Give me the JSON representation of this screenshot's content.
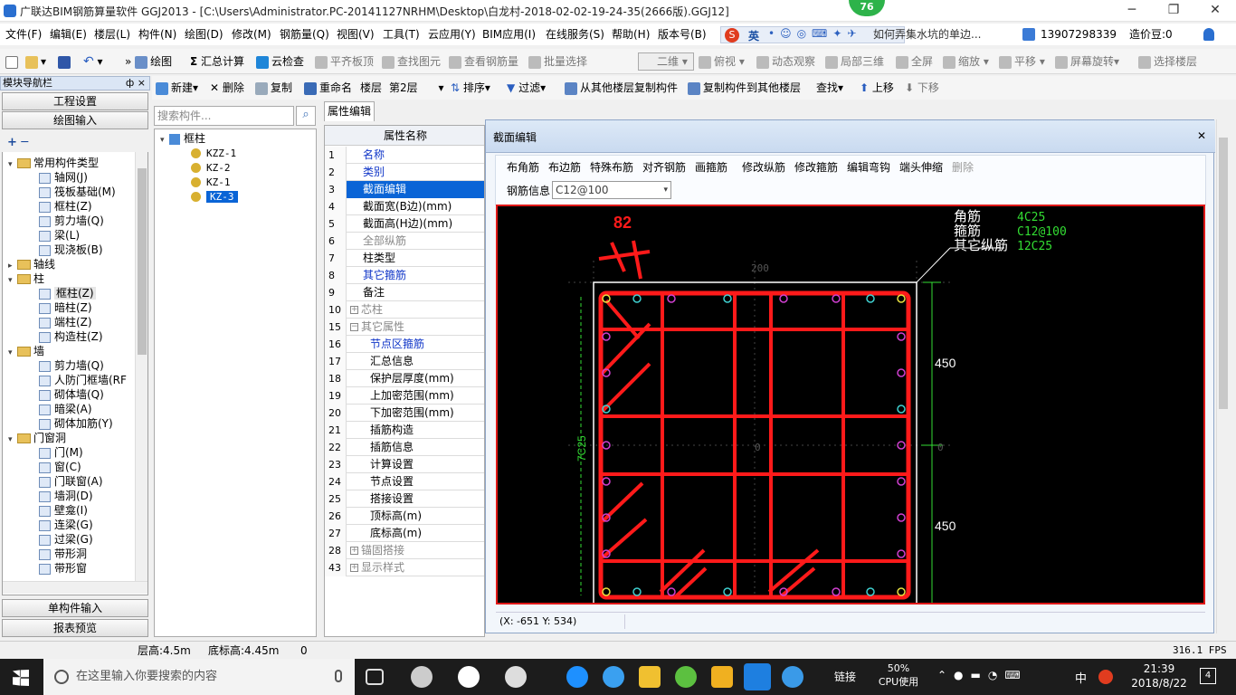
{
  "window": {
    "title": "广联达BIM钢筋算量软件 GGJ2013 - [C:\\Users\\Administrator.PC-20141127NRHM\\Desktop\\白龙村-2018-02-02-19-24-35(2666版).GGJ12]",
    "notification_count": "76"
  },
  "menu": [
    "文件(F)",
    "编辑(E)",
    "楼层(L)",
    "构件(N)",
    "绘图(D)",
    "修改(M)",
    "钢筋量(Q)",
    "视图(V)",
    "工具(T)",
    "云应用(Y)",
    "BIM应用(I)",
    "在线服务(S)",
    "帮助(H)",
    "版本号(B)"
  ],
  "menu_right": {
    "ime_label": "英",
    "news_text": "如何弄集水坑的单边...",
    "phone": "13907298339",
    "coins": "造价豆:0"
  },
  "toolbar1": {
    "draw": "绘图",
    "sum": "汇总计算",
    "cloud_check": "云检查",
    "flush_slab": "平齐板顶",
    "find_elem": "查找图元",
    "view_rebar": "查看钢筋量",
    "batch_select": "批量选择",
    "view_mode": "二维",
    "top_view": "俯视",
    "dynamic": "动态观察",
    "local3d": "局部三维",
    "fullscreen": "全屏",
    "zoom": "缩放",
    "pan": "平移",
    "rotate": "屏幕旋转",
    "select_floor": "选择楼层"
  },
  "toolbar2": {
    "new": "新建",
    "delete": "删除",
    "copy": "复制",
    "rename": "重命名",
    "floor_label": "楼层",
    "floor_value": "第2层",
    "sort": "排序",
    "filter": "过滤",
    "copy_from": "从其他楼层复制构件",
    "copy_to": "复制构件到其他楼层",
    "find": "查找",
    "up": "上移",
    "down": "下移"
  },
  "nav": {
    "title": "模块导航栏",
    "pin": "ф ×",
    "project_settings": "工程设置",
    "drawing_input": "绘图输入",
    "single_input": "单构件输入",
    "report_preview": "报表预览"
  },
  "tree": [
    {
      "label": "常用构件类型",
      "type": "folder",
      "expanded": "-"
    },
    {
      "label": "轴网(J)",
      "type": "item"
    },
    {
      "label": "筏板基础(M)",
      "type": "item"
    },
    {
      "label": "框柱(Z)",
      "type": "item"
    },
    {
      "label": "剪力墙(Q)",
      "type": "item"
    },
    {
      "label": "梁(L)",
      "type": "item"
    },
    {
      "label": "现浇板(B)",
      "type": "item"
    },
    {
      "label": "轴线",
      "type": "folder",
      "expanded": "+"
    },
    {
      "label": "柱",
      "type": "folder",
      "expanded": "-"
    },
    {
      "label": "框柱(Z)",
      "type": "item",
      "selected": true
    },
    {
      "label": "暗柱(Z)",
      "type": "item"
    },
    {
      "label": "端柱(Z)",
      "type": "item"
    },
    {
      "label": "构造柱(Z)",
      "type": "item"
    },
    {
      "label": "墙",
      "type": "folder",
      "expanded": "-"
    },
    {
      "label": "剪力墙(Q)",
      "type": "item"
    },
    {
      "label": "人防门框墙(RF",
      "type": "item"
    },
    {
      "label": "砌体墙(Q)",
      "type": "item"
    },
    {
      "label": "暗梁(A)",
      "type": "item"
    },
    {
      "label": "砌体加筋(Y)",
      "type": "item"
    },
    {
      "label": "门窗洞",
      "type": "folder",
      "expanded": "-"
    },
    {
      "label": "门(M)",
      "type": "item"
    },
    {
      "label": "窗(C)",
      "type": "item"
    },
    {
      "label": "门联窗(A)",
      "type": "item"
    },
    {
      "label": "墙洞(D)",
      "type": "item"
    },
    {
      "label": "壁龛(I)",
      "type": "item"
    },
    {
      "label": "连梁(G)",
      "type": "item"
    },
    {
      "label": "过梁(G)",
      "type": "item"
    },
    {
      "label": "带形洞",
      "type": "item"
    },
    {
      "label": "带形窗",
      "type": "item"
    }
  ],
  "components": {
    "search_placeholder": "搜索构件...",
    "root": "框柱",
    "items": [
      "KZZ-1",
      "KZ-2",
      "KZ-1",
      "KZ-3"
    ]
  },
  "props": {
    "tab": "属性编辑",
    "header": "属性名称",
    "rows": [
      {
        "n": "1",
        "label": "名称",
        "style": "blue"
      },
      {
        "n": "2",
        "label": "类别",
        "style": "blue"
      },
      {
        "n": "3",
        "label": "截面编辑",
        "style": "sel"
      },
      {
        "n": "4",
        "label": "截面宽(B边)(mm)",
        "style": ""
      },
      {
        "n": "5",
        "label": "截面高(H边)(mm)",
        "style": ""
      },
      {
        "n": "6",
        "label": "全部纵筋",
        "style": "gray"
      },
      {
        "n": "7",
        "label": "柱类型",
        "style": ""
      },
      {
        "n": "8",
        "label": "其它箍筋",
        "style": "blue"
      },
      {
        "n": "9",
        "label": "备注",
        "style": ""
      },
      {
        "n": "10",
        "label": "芯柱",
        "style": "gray",
        "plus": "+"
      },
      {
        "n": "15",
        "label": "其它属性",
        "style": "gray",
        "plus": "-"
      },
      {
        "n": "16",
        "label": "节点区箍筋",
        "style": "blue",
        "indent": true
      },
      {
        "n": "17",
        "label": "汇总信息",
        "style": "",
        "indent": true
      },
      {
        "n": "18",
        "label": "保护层厚度(mm)",
        "style": "",
        "indent": true
      },
      {
        "n": "19",
        "label": "上加密范围(mm)",
        "style": "",
        "indent": true
      },
      {
        "n": "20",
        "label": "下加密范围(mm)",
        "style": "",
        "indent": true
      },
      {
        "n": "21",
        "label": "插筋构造",
        "style": "",
        "indent": true
      },
      {
        "n": "22",
        "label": "插筋信息",
        "style": "",
        "indent": true
      },
      {
        "n": "23",
        "label": "计算设置",
        "style": "",
        "indent": true
      },
      {
        "n": "24",
        "label": "节点设置",
        "style": "",
        "indent": true
      },
      {
        "n": "25",
        "label": "搭接设置",
        "style": "",
        "indent": true
      },
      {
        "n": "26",
        "label": "顶标高(m)",
        "style": "",
        "indent": true
      },
      {
        "n": "27",
        "label": "底标高(m)",
        "style": "",
        "indent": true
      },
      {
        "n": "28",
        "label": "锚固搭接",
        "style": "gray",
        "plus": "+"
      },
      {
        "n": "43",
        "label": "显示样式",
        "style": "gray",
        "plus": "+"
      }
    ]
  },
  "section_editor": {
    "title": "截面编辑",
    "tools": [
      "布角筋",
      "布边筋",
      "特殊布筋",
      "对齐钢筋",
      "画箍筋",
      "修改纵筋",
      "修改箍筋",
      "编辑弯钩",
      "端头伸缩",
      "删除"
    ],
    "rebar_info_label": "钢筋信息",
    "rebar_info_value": "C12@100",
    "legend": [
      {
        "name": "角筋",
        "value": "4C25"
      },
      {
        "name": "箍筋",
        "value": "C12@100"
      },
      {
        "name": "其它纵筋",
        "value": "12C25"
      }
    ],
    "dim_top": "200",
    "dim_right_top": "450",
    "dim_right_bottom": "450",
    "dim_left": "7C25",
    "dim_zero_mid": "0",
    "dim_zero_right": "0",
    "red_label": "82",
    "coord": "(X: -651 Y: 534)"
  },
  "status": {
    "floor_height": "层高:4.5m",
    "bottom_elev": "底标高:4.45m",
    "value": "0",
    "fps": "316.1 FPS"
  },
  "taskbar": {
    "search_placeholder": "在这里输入你要搜索的内容",
    "link": "链接",
    "cpu_pct": "50%",
    "cpu_label": "CPU使用",
    "ime": "中",
    "time": "21:39",
    "date": "2018/8/22",
    "notif": "4"
  },
  "colors": {
    "canvas_bg": "#000000",
    "rebar_red": "#ff1a1a",
    "legend_green": "#33dd33",
    "selection_blue": "#0a64d6"
  }
}
